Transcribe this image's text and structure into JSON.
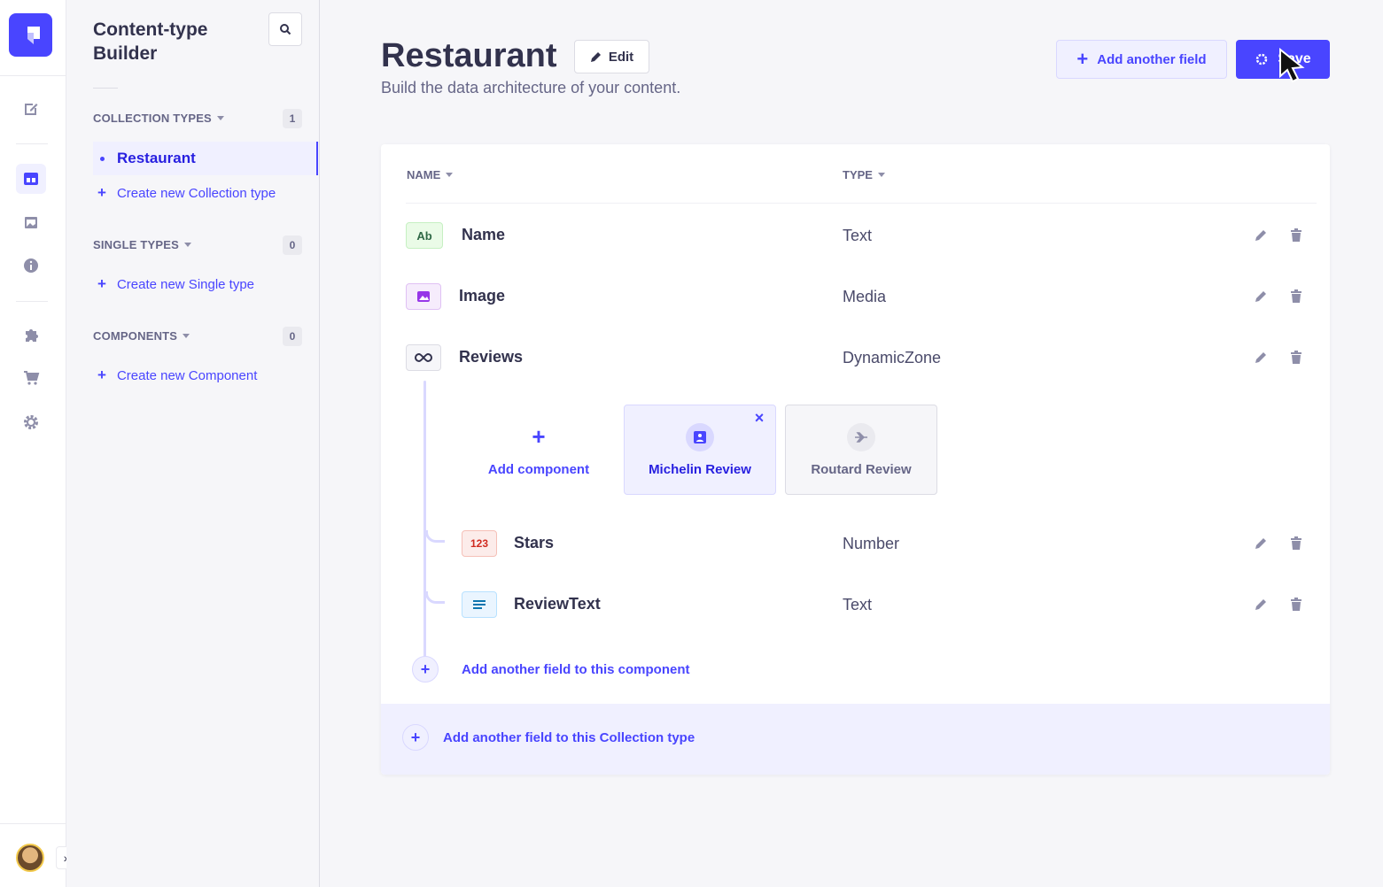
{
  "sidebar_rail": {
    "icons": [
      "logo-icon",
      "content-manager-icon",
      "content-type-builder-icon",
      "media-library-icon",
      "info-icon",
      "plugins-icon",
      "marketplace-icon",
      "settings-icon"
    ]
  },
  "subnav": {
    "title": "Content-type Builder",
    "collection_types": {
      "label": "COLLECTION TYPES",
      "count": "1",
      "items": [
        "Restaurant"
      ],
      "create_label": "Create new Collection type"
    },
    "single_types": {
      "label": "SINGLE TYPES",
      "count": "0",
      "create_label": "Create new Single type"
    },
    "components": {
      "label": "COMPONENTS",
      "count": "0",
      "create_label": "Create new Component"
    }
  },
  "header": {
    "title": "Restaurant",
    "edit_label": "Edit",
    "subtitle": "Build the data architecture of your content.",
    "add_field_label": "Add another field",
    "save_label": "Save"
  },
  "table": {
    "columns": [
      "NAME",
      "TYPE"
    ],
    "fields": [
      {
        "icon_text": "Ab",
        "icon": "text-icon",
        "name": "Name",
        "type": "Text"
      },
      {
        "icon_text": "",
        "icon": "media-icon",
        "name": "Image",
        "type": "Media"
      },
      {
        "icon_text": "",
        "icon": "dynamic-zone-icon",
        "name": "Reviews",
        "type": "DynamicZone"
      }
    ],
    "dynamic_zone": {
      "add_component_label": "Add component",
      "components": [
        {
          "name": "Michelin Review",
          "selected": true
        },
        {
          "name": "Routard Review",
          "selected": false
        }
      ],
      "component_fields": [
        {
          "icon_text": "123",
          "icon": "number-icon",
          "name": "Stars",
          "type": "Number"
        },
        {
          "icon_text": "",
          "icon": "richtext-icon",
          "name": "ReviewText",
          "type": "Text"
        }
      ],
      "add_field_label": "Add another field to this component"
    },
    "add_collection_field_label": "Add another field to this Collection type"
  },
  "colors": {
    "primary": "#4945ff",
    "primary_light": "#f0f0ff",
    "text": "#32324d",
    "muted": "#666687"
  }
}
